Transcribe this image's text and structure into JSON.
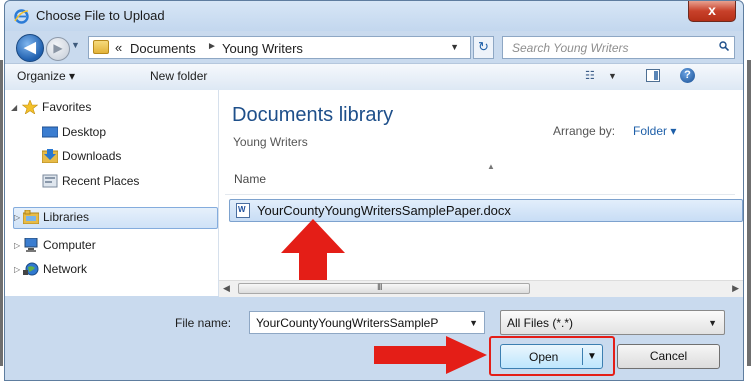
{
  "window": {
    "title": "Choose File to Upload",
    "close_label": "x"
  },
  "address_bar": {
    "overflow": "«",
    "crumbs": [
      "Documents",
      "Young Writers"
    ],
    "separator": "►"
  },
  "search": {
    "placeholder": "Search Young Writers"
  },
  "toolbar": {
    "organize": "Organize ▾",
    "new_folder": "New folder",
    "help": "?"
  },
  "sidebar": {
    "favorites": "Favorites",
    "desktop": "Desktop",
    "downloads": "Downloads",
    "recent_places": "Recent Places",
    "libraries": "Libraries",
    "computer": "Computer",
    "network": "Network"
  },
  "library": {
    "title": "Documents library",
    "subtitle": "Young Writers",
    "arrange_label": "Arrange by:",
    "arrange_value": "Folder ▾",
    "column_name": "Name"
  },
  "files": [
    {
      "name": "YourCountyYoungWritersSamplePaper.docx",
      "selected": true
    }
  ],
  "footer": {
    "file_name_label": "File name:",
    "file_name_value": "YourCountyYoungWritersSampleP",
    "file_type": "All Files (*.*)",
    "open_label": "Open",
    "cancel_label": "Cancel"
  },
  "scrollbar": {
    "grip": "III"
  },
  "annotations": {
    "arrow_color": "#e41e17"
  },
  "colors": {
    "accent": "#1e4f8a",
    "selection": "#cfe2f7",
    "annotation_red": "#e41e17"
  },
  "icons": {
    "app": "internet-explorer-icon",
    "back": "back-arrow-icon",
    "forward": "forward-arrow-icon",
    "folder": "folder-icon",
    "refresh": "refresh-icon",
    "search": "search-icon",
    "view": "view-options-icon",
    "preview_pane": "preview-pane-icon",
    "help": "help-icon",
    "star": "star-icon",
    "desktop": "desktop-icon",
    "downloads": "downloads-icon",
    "recent": "recent-places-icon",
    "libraries": "libraries-icon",
    "computer": "computer-icon",
    "network": "network-icon",
    "document": "word-document-icon"
  }
}
